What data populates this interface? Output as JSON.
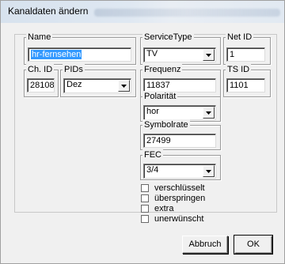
{
  "window": {
    "title": "Kanaldaten ändern"
  },
  "fields": {
    "name": {
      "label": "Name",
      "value": "hr-fernsehen"
    },
    "service_type": {
      "label": "ServiceType",
      "value": "TV"
    },
    "net_id": {
      "label": "Net ID",
      "value": "1"
    },
    "ch_id": {
      "label": "Ch. ID",
      "value": "28108"
    },
    "pids": {
      "label": "PIDs",
      "value": "Dez"
    },
    "frequenz": {
      "label": "Frequenz",
      "value": "11837"
    },
    "ts_id": {
      "label": "TS ID",
      "value": "1101"
    },
    "polaritaet": {
      "label": "Polarität",
      "value": "hor"
    },
    "symbolrate": {
      "label": "Symbolrate",
      "value": "27499"
    },
    "fec": {
      "label": "FEC",
      "value": "3/4"
    }
  },
  "checkboxes": [
    {
      "label": "verschlüsselt",
      "checked": false
    },
    {
      "label": "überspringen",
      "checked": false
    },
    {
      "label": "extra",
      "checked": false
    },
    {
      "label": "unerwünscht",
      "checked": false
    }
  ],
  "buttons": {
    "cancel": "Abbruch",
    "ok": "OK"
  },
  "icons": {
    "dropdown": "chevron-down-icon"
  }
}
